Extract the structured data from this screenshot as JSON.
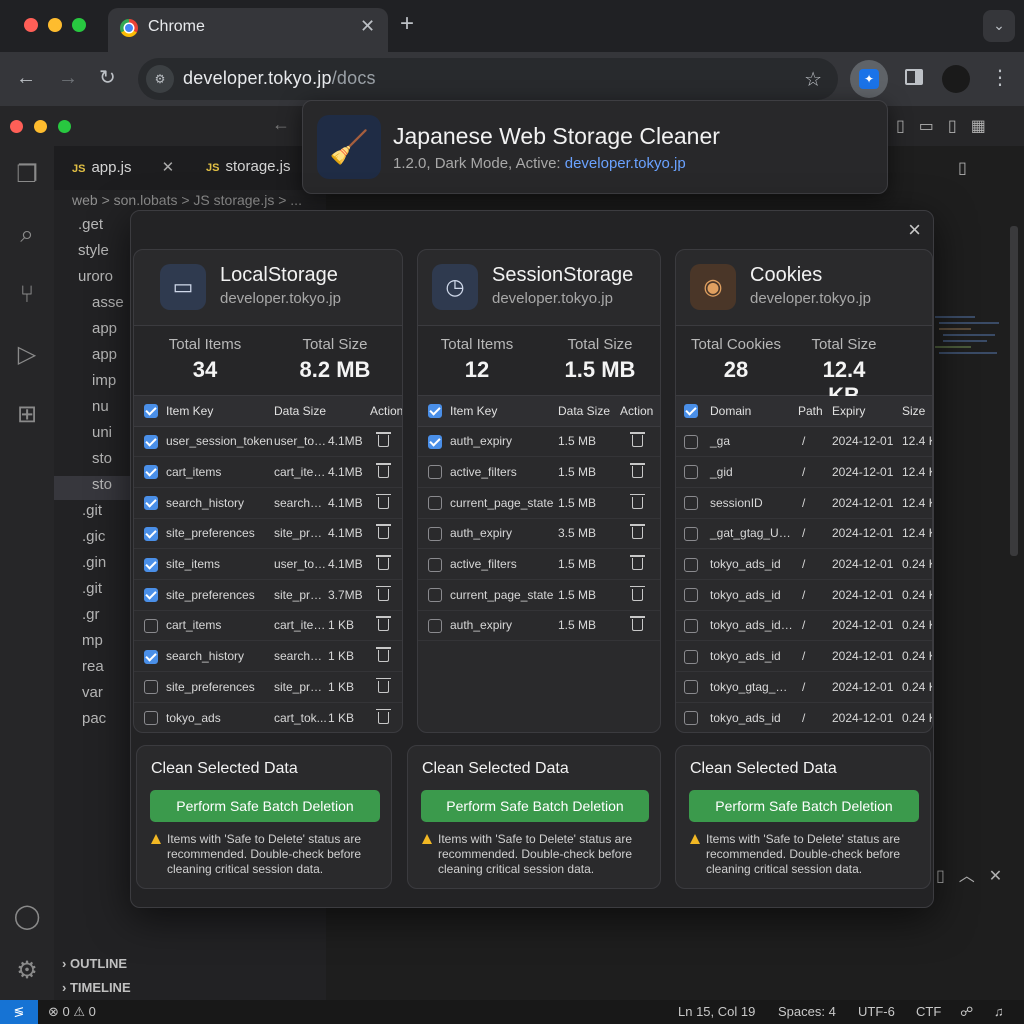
{
  "browser": {
    "tab_title": "Chrome",
    "url_host": "developer.tokyo.jp",
    "url_path": "/docs"
  },
  "extension_popup": {
    "title": "Japanese Web Storage Cleaner",
    "subtitle_prefix": "1.2.0, Dark Mode, Active: ",
    "active_domain": "developer.tokyo.jp"
  },
  "editor": {
    "tabs": [
      "app.js",
      "storage.js"
    ],
    "breadcrumb": "web > son.lobats > JS storage.js > ...",
    "tree": [
      ".get",
      "style",
      "uroro",
      "asse",
      "app",
      "app",
      "imp",
      "nu",
      "uni",
      "sto",
      "sto",
      ".git",
      ".gic",
      ".gin",
      ".git",
      ".gr",
      "mp",
      "rea",
      "var",
      "pac"
    ],
    "outline_label": "OUTLINE",
    "timeline_label": "TIMELINE",
    "status": {
      "problems": "0",
      "warnings": "0",
      "position": "Ln 15, Col 19",
      "spaces": "Spaces: 4",
      "encoding": "UTF-6",
      "eol": "CTF"
    }
  },
  "local": {
    "title": "LocalStorage",
    "domain": "developer.tokyo.jp",
    "stat1_label": "Total Items",
    "stat1_value": "34",
    "stat2_label": "Total Size",
    "stat2_value": "8.2 MB",
    "headers": [
      "Item Key",
      "Data Size",
      "Action"
    ],
    "rows": [
      {
        "checked": true,
        "key": "user_session_token",
        "data": "user_token",
        "size": "4.1MB"
      },
      {
        "checked": true,
        "key": "cart_items",
        "data": "cart_items",
        "size": "4.1MB"
      },
      {
        "checked": true,
        "key": "search_history",
        "data": "search_h...",
        "size": "4.1MB"
      },
      {
        "checked": true,
        "key": "site_preferences",
        "data": "site_pref...",
        "size": "4.1MB"
      },
      {
        "checked": true,
        "key": "site_items",
        "data": "user_token",
        "size": "4.1MB"
      },
      {
        "checked": true,
        "key": "site_preferences",
        "data": "site_pref...",
        "size": "3.7MB"
      },
      {
        "checked": false,
        "key": "cart_items",
        "data": "cart_items",
        "size": "1 KB"
      },
      {
        "checked": true,
        "key": "search_history",
        "data": "search_h...",
        "size": "1 KB"
      },
      {
        "checked": false,
        "key": "site_preferences",
        "data": "site_pref...",
        "size": "1 KB"
      },
      {
        "checked": false,
        "key": "tokyo_ads",
        "data": "cart_tok...",
        "size": "1 KB"
      }
    ]
  },
  "session": {
    "title": "SessionStorage",
    "domain": "developer.tokyo.jp",
    "stat1_label": "Total Items",
    "stat1_value": "12",
    "stat2_label": "Total Size",
    "stat2_value": "1.5 MB",
    "headers": [
      "Item Key",
      "Data Size",
      "Action"
    ],
    "rows": [
      {
        "checked": true,
        "key": "auth_expiry",
        "size": "1.5 MB"
      },
      {
        "checked": false,
        "key": "active_filters",
        "size": "1.5 MB"
      },
      {
        "checked": false,
        "key": "current_page_state",
        "size": "1.5 MB"
      },
      {
        "checked": false,
        "key": "auth_expiry",
        "size": "3.5 MB"
      },
      {
        "checked": false,
        "key": "active_filters",
        "size": "1.5 MB"
      },
      {
        "checked": false,
        "key": "current_page_state",
        "size": "1.5 MB"
      },
      {
        "checked": false,
        "key": "auth_expiry",
        "size": "1.5 MB"
      }
    ]
  },
  "cookies": {
    "title": "Cookies",
    "domain": "developer.tokyo.jp",
    "stat1_label": "Total Cookies",
    "stat1_value": "28",
    "stat2_label": "Total Size",
    "stat2_value": "12.4 KB",
    "headers": [
      "Domain",
      "Path",
      "Expiry",
      "Size"
    ],
    "rows": [
      {
        "checked": false,
        "domain": "_ga",
        "path": "/",
        "expiry": "2024-12-01",
        "size": "12.4 K"
      },
      {
        "checked": false,
        "domain": "_gid",
        "path": "/",
        "expiry": "2024-12-01",
        "size": "12.4 K"
      },
      {
        "checked": false,
        "domain": "sessionID",
        "path": "/",
        "expiry": "2024-12-01",
        "size": "12.4 K"
      },
      {
        "checked": false,
        "domain": "_gat_gtag_UA...",
        "path": "/",
        "expiry": "2024-12-01",
        "size": "12.4 K"
      },
      {
        "checked": false,
        "domain": "tokyo_ads_id",
        "path": "/",
        "expiry": "2024-12-01",
        "size": "0.24 K"
      },
      {
        "checked": false,
        "domain": "tokyo_ads_id",
        "path": "/",
        "expiry": "2024-12-01",
        "size": "0.24 K"
      },
      {
        "checked": false,
        "domain": "tokyo_ads_id....",
        "path": "/",
        "expiry": "2024-12-01",
        "size": "0.24 K"
      },
      {
        "checked": false,
        "domain": "tokyo_ads_id",
        "path": "/",
        "expiry": "2024-12-01",
        "size": "0.24 K"
      },
      {
        "checked": false,
        "domain": "tokyo_gtag_U...",
        "path": "/",
        "expiry": "2024-12-01",
        "size": "0.24 K"
      },
      {
        "checked": false,
        "domain": "tokyo_ads_id",
        "path": "/",
        "expiry": "2024-12-01",
        "size": "0.24 K"
      }
    ]
  },
  "clean": {
    "title": "Clean Selected Data",
    "button": "Perform Safe Batch Deletion",
    "warning": "Items with 'Safe to Delete' status are recommended. Double-check before cleaning critical session data."
  },
  "colors": {
    "accent": "#4a8fe8",
    "action_green": "#3b9a4c",
    "warning": "#f2b824"
  },
  "icons": {
    "extension": "broom-icon",
    "local": "drive-icon",
    "session": "history-clock-icon",
    "cookies": "cookie-icon"
  }
}
